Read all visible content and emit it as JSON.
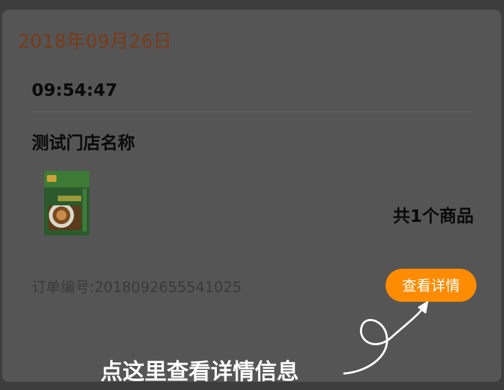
{
  "order": {
    "date": "2018年09月26日",
    "time": "09:54:47",
    "store_name": "测试门店名称",
    "item_count": "共1个商品",
    "order_number": "订单编号:2018092655541025",
    "detail_button": "查看详情"
  },
  "tutorial": {
    "hint_text": "点这里查看详情信息"
  },
  "colors": {
    "accent": "#ff8c00",
    "date_text": "#7a3a17",
    "overlay": "#3d3d3d"
  },
  "icons": {
    "product_image": "seasoning-package-image",
    "pointer": "curly-arrow-icon"
  }
}
